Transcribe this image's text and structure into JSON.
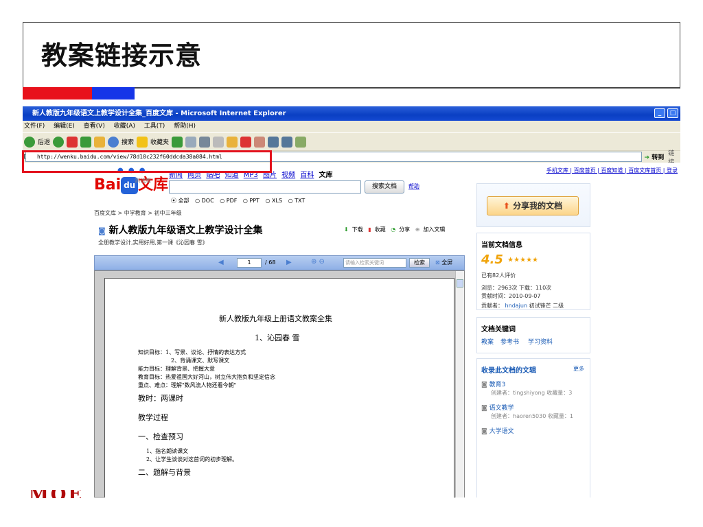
{
  "slide": {
    "title": "教案链接示意",
    "footer_logo": "MOE"
  },
  "browser": {
    "window_title": "新人教版九年级语文上教学设计全集_百度文库 - Microsoft Internet Explorer",
    "menu": [
      "文件(F)",
      "编辑(E)",
      "查看(V)",
      "收藏(A)",
      "工具(T)",
      "帮助(H)"
    ],
    "toolbar": {
      "back": "后退",
      "search": "搜索",
      "favorites": "收藏夹"
    },
    "address_label": "地址(D)",
    "url": "http://wenku.baidu.com/view/78d10c232f60ddcda38a084.html",
    "go_label": "转到",
    "links_label": "链接"
  },
  "wenku": {
    "top_links": "手机文库 | 百度首页 | 百度知道 | 百度文库首页 | 登录",
    "logo_bai": "Bai",
    "logo_du": "du",
    "logo_wenku": "文库",
    "beta": "测试版",
    "nav": [
      "新闻",
      "网页",
      "贴吧",
      "知道",
      "MP3",
      "图片",
      "视频",
      "百科"
    ],
    "nav_current": "文库",
    "search_button": "搜索文档",
    "help": "帮助",
    "filters": [
      "⦿ 全部",
      "○ DOC",
      "○ PDF",
      "○ PPT",
      "○ XLS",
      "○ TXT"
    ],
    "breadcrumb": "百度文库 > 中学教育 > 初中三年级",
    "doc_title": "新人教版九年级语文上教学设计全集",
    "doc_subtitle": "全册教学设计,实用好用,第一课《沁园春 雪》",
    "actions": [
      "下载",
      "收藏",
      "分享",
      "加入文辑"
    ],
    "viewer": {
      "page": "1",
      "total": "/ 68",
      "search_placeholder": "请输入检索关键词",
      "search_btn": "检索",
      "fullscreen": "全屏"
    },
    "doc_content": {
      "heading": "新人教版九年级上册语文教案全集",
      "lesson": "1、沁园春 雪",
      "lines": [
        "知识目标：1、写景、议论、抒情的表达方式",
        "2、背诵课文、默写课文",
        "能力目标：理解背景、把握大意",
        "教育目标：热爱祖国大好河山，树立伟大抱负和坚定信念",
        "重点、难点：理解\"数风流人物还看今朝\""
      ],
      "period": "教时：两课时",
      "process": "教学过程",
      "section1": "一、检查预习",
      "items": [
        "1、指名朗读课文",
        "2、让学生谈谈对这首词的初步理解。"
      ],
      "section2": "二、题解与背景"
    },
    "sidebar": {
      "share_button": "分享我的文档",
      "info_title": "当前文档信息",
      "rating": "4.5",
      "stars": "★★★★★",
      "reviews": "已有82人评价",
      "stats": "浏览：2963次  下载：110次",
      "contrib_time": "贡献时间：2010-09-07",
      "contributor": "贡献者：",
      "contributor_name": "hndajun",
      "contributor_level": "初试锋芒 二级",
      "keywords_title": "文档关键词",
      "keywords": [
        "教案",
        "参考书",
        "学习资料"
      ],
      "collections_title": "收录此文档的文辑",
      "more": "更多",
      "collections": [
        {
          "name": "教育3",
          "meta": "创建者：tingshiyong  收藏量：3"
        },
        {
          "name": "语文教学",
          "meta": "创建者：haoren5030  收藏量：1"
        },
        {
          "name": "大学语文",
          "meta": ""
        }
      ]
    }
  }
}
